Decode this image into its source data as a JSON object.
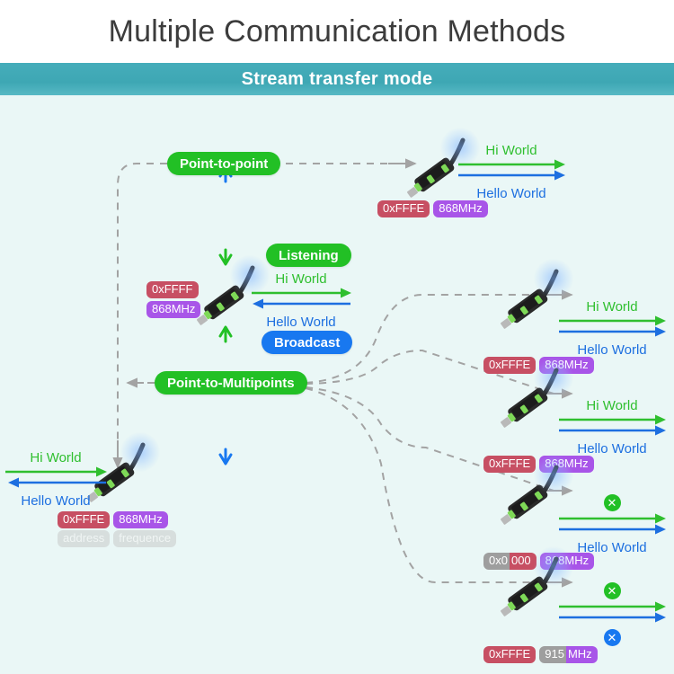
{
  "header": {
    "title": "Multiple Communication Methods",
    "subtitle": "Stream transfer mode",
    "bar_color": "#3ea7b4",
    "canvas_color": "#eaf7f6"
  },
  "labels": {
    "point_to_point": "Point-to-point",
    "point_to_multipoints": "Point-to-Multipoints",
    "listening": "Listening",
    "broadcast": "Broadcast",
    "address_caption": "address",
    "frequence_caption": "frequence",
    "msg_up": "Hi World",
    "msg_down": "Hello World",
    "blocked_mark": "✕"
  },
  "colors": {
    "green": "#22c025",
    "blue": "#1878f0",
    "address_badge": "#c74f63",
    "freq_badge": "#a855e8",
    "muted_badge": "#9e9e9e",
    "msg_green": "#2fbf2f",
    "msg_blue": "#1d6fe0",
    "wire": "#a3a3a3"
  },
  "nodes": {
    "center": {
      "address": "0xFFFF",
      "frequency": "868MHz",
      "msg_up": "Hi World",
      "msg_down": "Hello World"
    },
    "peer_top_right": {
      "address": "0xFFFE",
      "frequency": "868MHz",
      "msg_up": "Hi World",
      "msg_down": "Hello World"
    },
    "peer_left": {
      "address": "0xFFFE",
      "frequency": "868MHz",
      "address_caption": "address",
      "frequence_caption": "frequence",
      "msg_up": "Hi World",
      "msg_down": "Hello World"
    },
    "multi_1": {
      "address": "0xFFFE",
      "frequency": "868MHz",
      "msg_up": "Hi World",
      "msg_down": "Hello World"
    },
    "multi_2": {
      "address": "0xFFFE",
      "frequency": "868MHz",
      "msg_up": "Hi World",
      "msg_down": "Hello World"
    },
    "multi_3": {
      "address_prefix": "0x0",
      "address_suffix": "000",
      "frequency": "868MHz",
      "msg_up": "✕",
      "msg_down": "Hello World"
    },
    "multi_4": {
      "address": "0xFFFE",
      "frequency_prefix": "915",
      "frequency_suffix": "MHz",
      "msg_up": "✕",
      "msg_down": "✕"
    }
  }
}
